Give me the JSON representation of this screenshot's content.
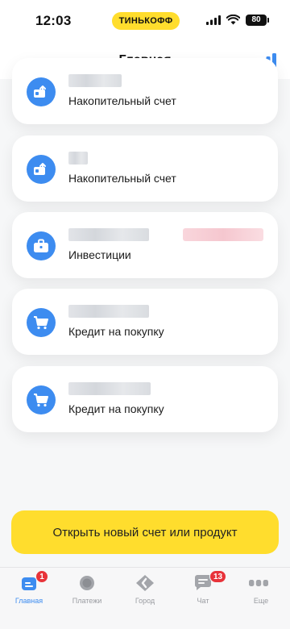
{
  "status_bar": {
    "time": "12:03",
    "bank_name": "ТИНЬКОФФ",
    "battery": "80"
  },
  "header": {
    "title": "Главная",
    "analytics_icon": "bar-chart-icon"
  },
  "cards": [
    {
      "label": "Накопительный счет",
      "icon": "savings-deposit-icon"
    },
    {
      "label": "Накопительный счет",
      "icon": "savings-deposit-icon"
    },
    {
      "label": "Инвестиции",
      "icon": "briefcase-icon"
    },
    {
      "label": "Кредит на покупку",
      "icon": "shopping-cart-icon"
    },
    {
      "label": "Кредит на покупку",
      "icon": "shopping-cart-icon"
    }
  ],
  "primary_button": {
    "label": "Открыть новый счет или продукт"
  },
  "tab_bar": {
    "tabs": [
      {
        "label": "Главная",
        "icon": "home-icon",
        "badge": "1"
      },
      {
        "label": "Платежи",
        "icon": "payments-icon"
      },
      {
        "label": "Город",
        "icon": "city-icon"
      },
      {
        "label": "Чат",
        "icon": "chat-icon",
        "badge": "13"
      },
      {
        "label": "Еще",
        "icon": "more-icon"
      }
    ]
  },
  "colors": {
    "accent_blue": "#3d8cf0",
    "brand_yellow": "#ffdd2d",
    "badge_red": "#e8333a"
  }
}
